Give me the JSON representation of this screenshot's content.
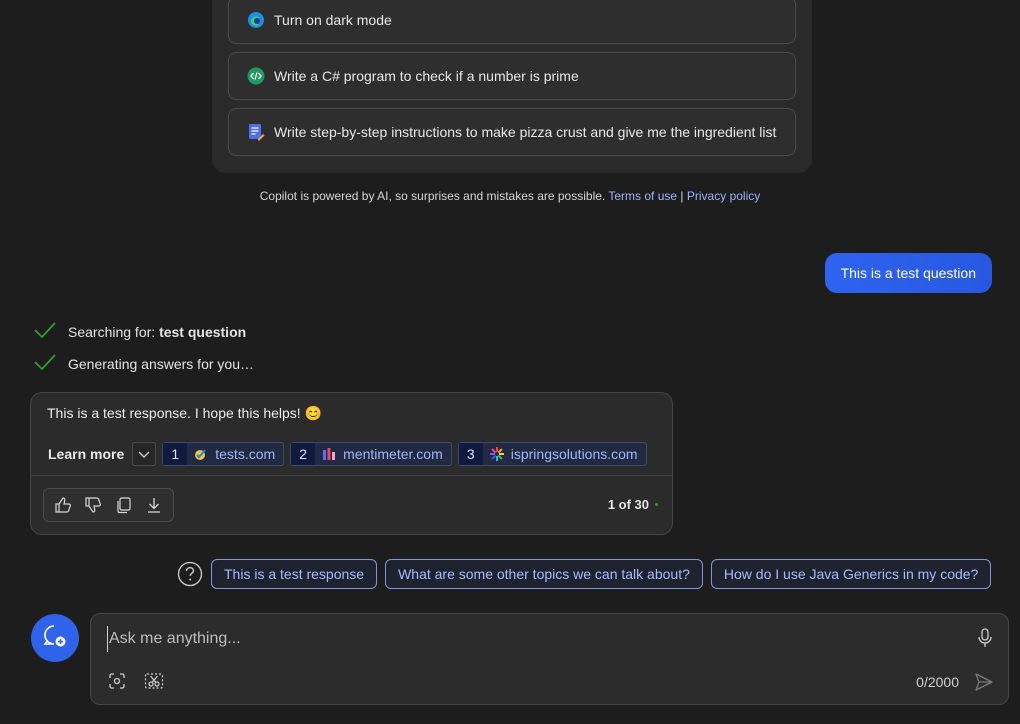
{
  "suggestions": [
    {
      "label": "Turn on dark mode",
      "icon": "edge-icon"
    },
    {
      "label": "Write a C# program to check if a number is prime",
      "icon": "code-icon"
    },
    {
      "label": "Write step-by-step instructions to make pizza crust and give me the ingredient list",
      "icon": "document-edit-icon"
    }
  ],
  "disclaimer": {
    "text": "Copilot is powered by AI, so surprises and mistakes are possible.",
    "terms_link": "Terms of use",
    "separator": "|",
    "privacy_link": "Privacy policy"
  },
  "user_message": "This is a test question",
  "status": {
    "searching_prefix": "Searching for:",
    "searching_query": "test question",
    "generating": "Generating answers for you…"
  },
  "response": {
    "text": "This is a test response. I hope this helps! 😊",
    "learn_more_label": "Learn more",
    "sources": [
      {
        "num": "1",
        "name": "tests.com"
      },
      {
        "num": "2",
        "name": "mentimeter.com"
      },
      {
        "num": "3",
        "name": "ispringsolutions.com"
      }
    ],
    "page_count": "1 of 30"
  },
  "followups": [
    "This is a test response",
    "What are some other topics we can talk about?",
    "How do I use Java Generics in my code?"
  ],
  "composer": {
    "placeholder": "Ask me anything...",
    "char_count": "0/2000"
  },
  "colors": {
    "background": "#1d1d1d",
    "accent_blue": "#2f63ea",
    "link": "#9db4ff",
    "check_green": "#2ca02c"
  }
}
